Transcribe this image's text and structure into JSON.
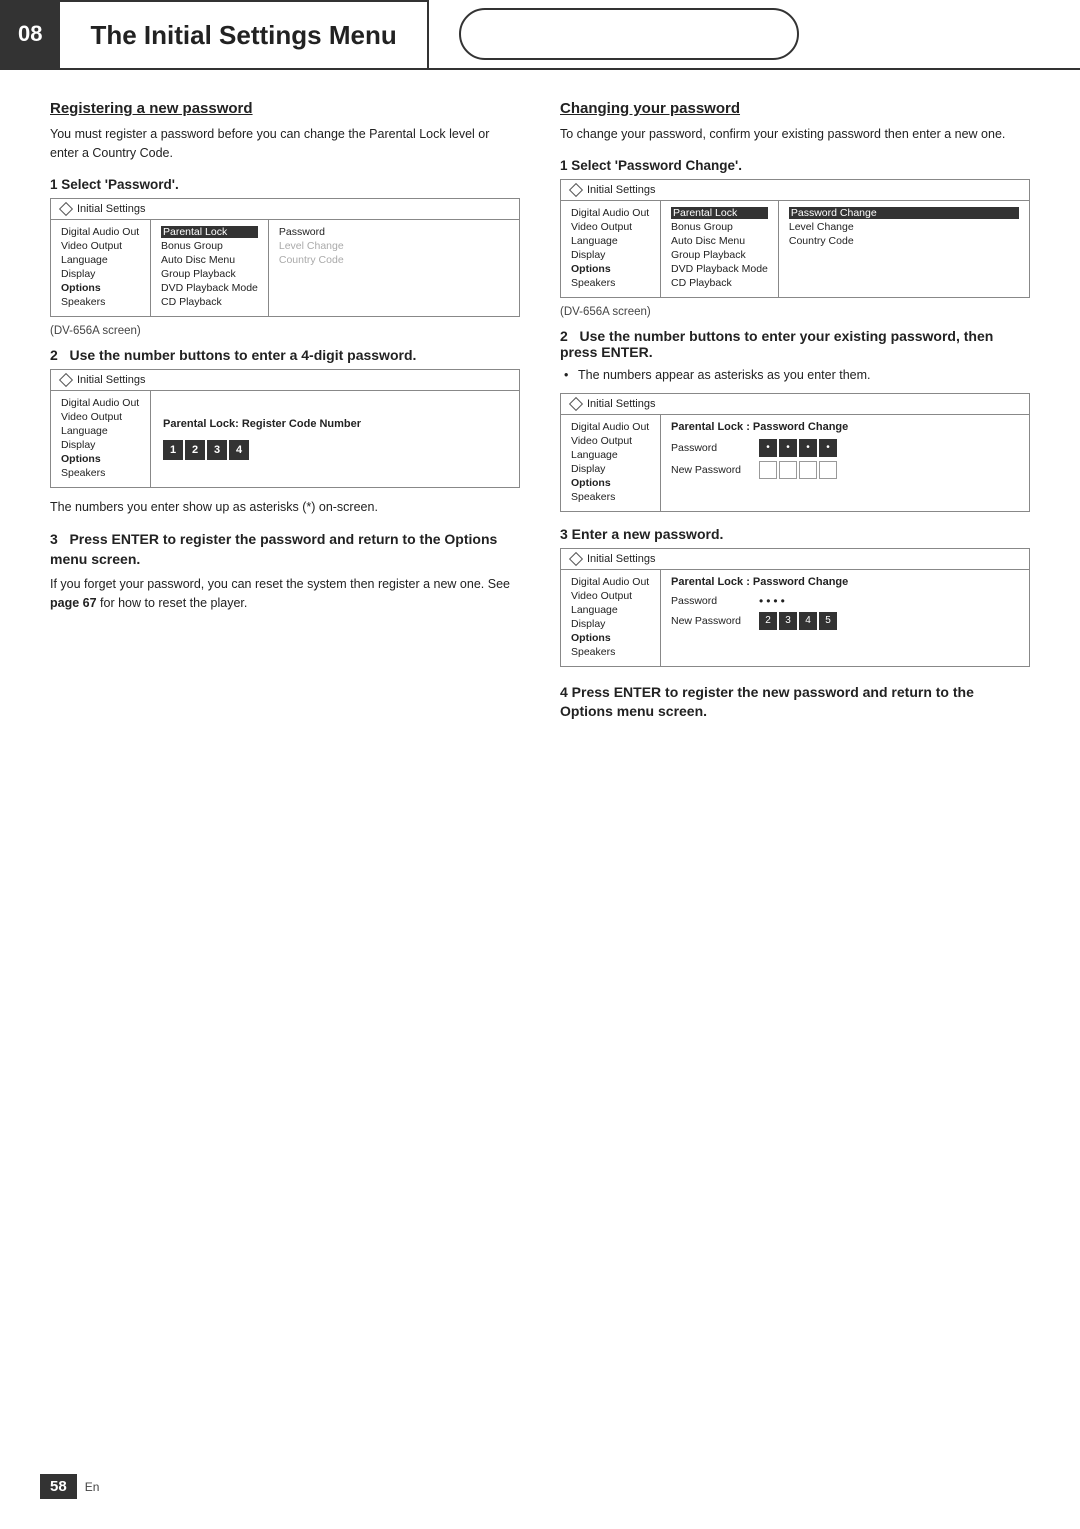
{
  "header": {
    "number": "08",
    "title": "The Initial Settings Menu",
    "pill": ""
  },
  "left_col": {
    "section_heading": "Registering a new password",
    "section_para": "You must register a password before you can change the Parental Lock level or enter a Country Code.",
    "step1": {
      "label": "1   Select 'Password'.",
      "screen_title": "Initial Settings",
      "menu_items": [
        "Digital Audio Out",
        "Video Output",
        "Language",
        "Display",
        "Options",
        "Speakers"
      ],
      "active_menu": "Options",
      "submenu_items": [
        "Parental Lock",
        "Bonus Group",
        "Auto Disc Menu",
        "Group Playback",
        "DVD Playback Mode",
        "CD Playback"
      ],
      "selected_submenu": "Parental Lock",
      "right_items": [
        "Password",
        "Level Change",
        "Country Code"
      ],
      "selected_right": "",
      "caption": "(DV-656A screen)"
    },
    "step2": {
      "label": "2   Use the number buttons to enter a 4-digit password.",
      "screen_title": "Initial Settings",
      "menu_items": [
        "Digital Audio Out",
        "Video Output",
        "Language",
        "Display",
        "Options",
        "Speakers"
      ],
      "active_menu": "Options",
      "center_label": "Parental Lock: Register Code Number",
      "digits": [
        "1",
        "2",
        "3",
        "4"
      ],
      "digits_filled": [
        true,
        true,
        true,
        true
      ]
    },
    "step2_note": "The numbers you enter show up as asterisks (*) on-screen.",
    "step3": {
      "label_bold": "3   Press ENTER to register the password and return to the Options menu screen.",
      "para": "If you forget your password, you can reset the system then register a new one. See",
      "para2": "page 67 for how to reset the player.",
      "page_ref": "page 67"
    }
  },
  "right_col": {
    "section_heading": "Changing your password",
    "section_para": "To change your password, confirm your existing password then enter a new one.",
    "step1": {
      "label": "1   Select 'Password Change'.",
      "screen_title": "Initial Settings",
      "menu_items": [
        "Digital Audio Out",
        "Video Output",
        "Language",
        "Display",
        "Options",
        "Speakers"
      ],
      "active_menu": "Options",
      "submenu_items": [
        "Parental Lock",
        "Bonus Group",
        "Auto Disc Menu",
        "Group Playback",
        "DVD Playback Mode",
        "CD Playback"
      ],
      "selected_submenu": "Parental Lock",
      "right_items": [
        "Password Change",
        "Level Change",
        "Country Code"
      ],
      "selected_right": "Password Change",
      "caption": "(DV-656A screen)"
    },
    "step2": {
      "label": "2   Use the number buttons to enter your existing password, then press ENTER.",
      "bullet": "The numbers appear as asterisks as you enter them.",
      "screen_title": "Initial Settings",
      "menu_items": [
        "Digital Audio Out",
        "Video Output",
        "Language",
        "Display",
        "Options",
        "Speakers"
      ],
      "active_menu": "Options",
      "pw_title": "Parental Lock : Password Change",
      "pw_label": "Password",
      "pw_dots": [
        "•",
        "•",
        "•",
        "•"
      ],
      "new_pw_label": "New Password",
      "new_pw_boxes": [
        "",
        "",
        "",
        ""
      ],
      "new_pw_filled": [
        false,
        false,
        false,
        false
      ]
    },
    "step3": {
      "label": "3   Enter a new password.",
      "screen_title": "Initial Settings",
      "menu_items": [
        "Digital Audio Out",
        "Video Output",
        "Language",
        "Display",
        "Options",
        "Speakers"
      ],
      "active_menu": "Options",
      "pw_title": "Parental Lock : Password Change",
      "pw_label": "Password",
      "pw_dots": [
        "•",
        "•",
        "•",
        "•"
      ],
      "new_pw_label": "New Password",
      "new_pw_digits": [
        "2",
        "3",
        "4",
        "5"
      ],
      "new_pw_filled": [
        true,
        true,
        true,
        true
      ]
    },
    "step4": {
      "label": "4   Press ENTER to register the new password and return to the Options menu screen."
    }
  },
  "footer": {
    "page_number": "58",
    "lang": "En"
  }
}
